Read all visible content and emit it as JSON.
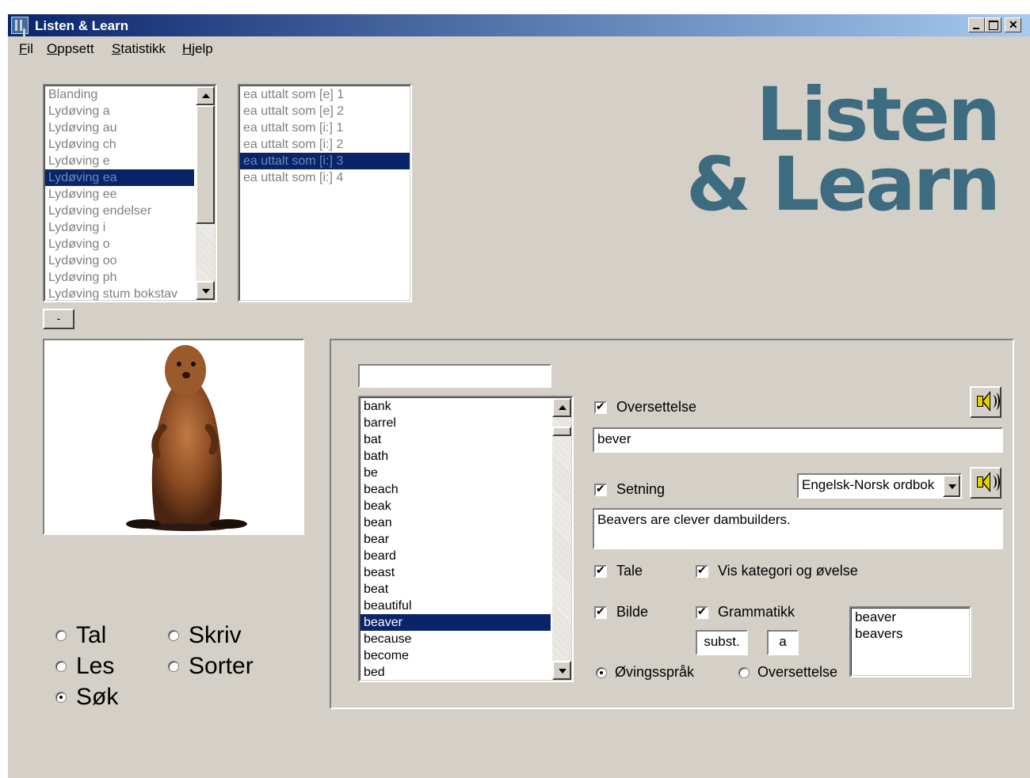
{
  "window": {
    "title": "Listen & Learn"
  },
  "menu": [
    {
      "mnemonic": "F",
      "rest": "il"
    },
    {
      "mnemonic": "O",
      "rest": "ppsett"
    },
    {
      "mnemonic": "S",
      "rest": "tatistikk"
    },
    {
      "mnemonic": "H",
      "rest": "jelp"
    }
  ],
  "categories": {
    "items": [
      "Blanding",
      "Lydøving a",
      "Lydøving au",
      "Lydøving ch",
      "Lydøving e",
      "Lydøving ea",
      "Lydøving ee",
      "Lydøving endelser",
      "Lydøving i",
      "Lydøving o",
      "Lydøving oo",
      "Lydøving ph",
      "Lydøving stum bokstav"
    ],
    "selected": "Lydøving ea"
  },
  "exercises": {
    "items": [
      "ea uttalt som [e] 1",
      "ea uttalt som [e] 2",
      "ea uttalt som [i:] 1",
      "ea uttalt som [i:] 2",
      "ea uttalt som [i:] 3",
      "ea uttalt som [i:] 4"
    ],
    "selected": "ea uttalt som [i:] 3"
  },
  "dash_button": "-",
  "logo": {
    "line1": "Listen",
    "line2": "& Learn"
  },
  "picture": {
    "subject": "beaver"
  },
  "modes": [
    {
      "label": "Tal",
      "checked": false
    },
    {
      "label": "Skriv",
      "checked": false
    },
    {
      "label": "Les",
      "checked": false
    },
    {
      "label": "Sorter",
      "checked": false
    },
    {
      "label": "Søk",
      "checked": true
    }
  ],
  "search": {
    "value": ""
  },
  "words": {
    "items": [
      "bank",
      "barrel",
      "bat",
      "bath",
      "be",
      "beach",
      "beak",
      "bean",
      "bear",
      "beard",
      "beast",
      "beat",
      "beautiful",
      "beaver",
      "because",
      "become",
      "bed"
    ],
    "selected": "beaver"
  },
  "options": {
    "oversettelse": {
      "label": "Oversettelse",
      "checked": true
    },
    "translation_value": "bever",
    "setning": {
      "label": "Setning",
      "checked": true
    },
    "dictionary": "Engelsk-Norsk ordbok",
    "sentence_value": "Beavers are clever dambuilders.",
    "tale": {
      "label": "Tale",
      "checked": true
    },
    "vis_kategori": {
      "label": "Vis kategori og øvelse",
      "checked": true
    },
    "bilde": {
      "label": "Bilde",
      "checked": true
    },
    "grammatikk": {
      "label": "Grammatikk",
      "checked": true
    },
    "word_class": "subst.",
    "article": "a",
    "forms": [
      "beaver",
      "beavers"
    ],
    "language_radio": [
      {
        "label": "Øvingsspråk",
        "checked": true
      },
      {
        "label": "Oversettelse",
        "checked": false
      }
    ]
  },
  "icons": [
    "speaker-icon",
    "minimize-icon",
    "maximize-icon",
    "close-icon",
    "app-icon"
  ]
}
